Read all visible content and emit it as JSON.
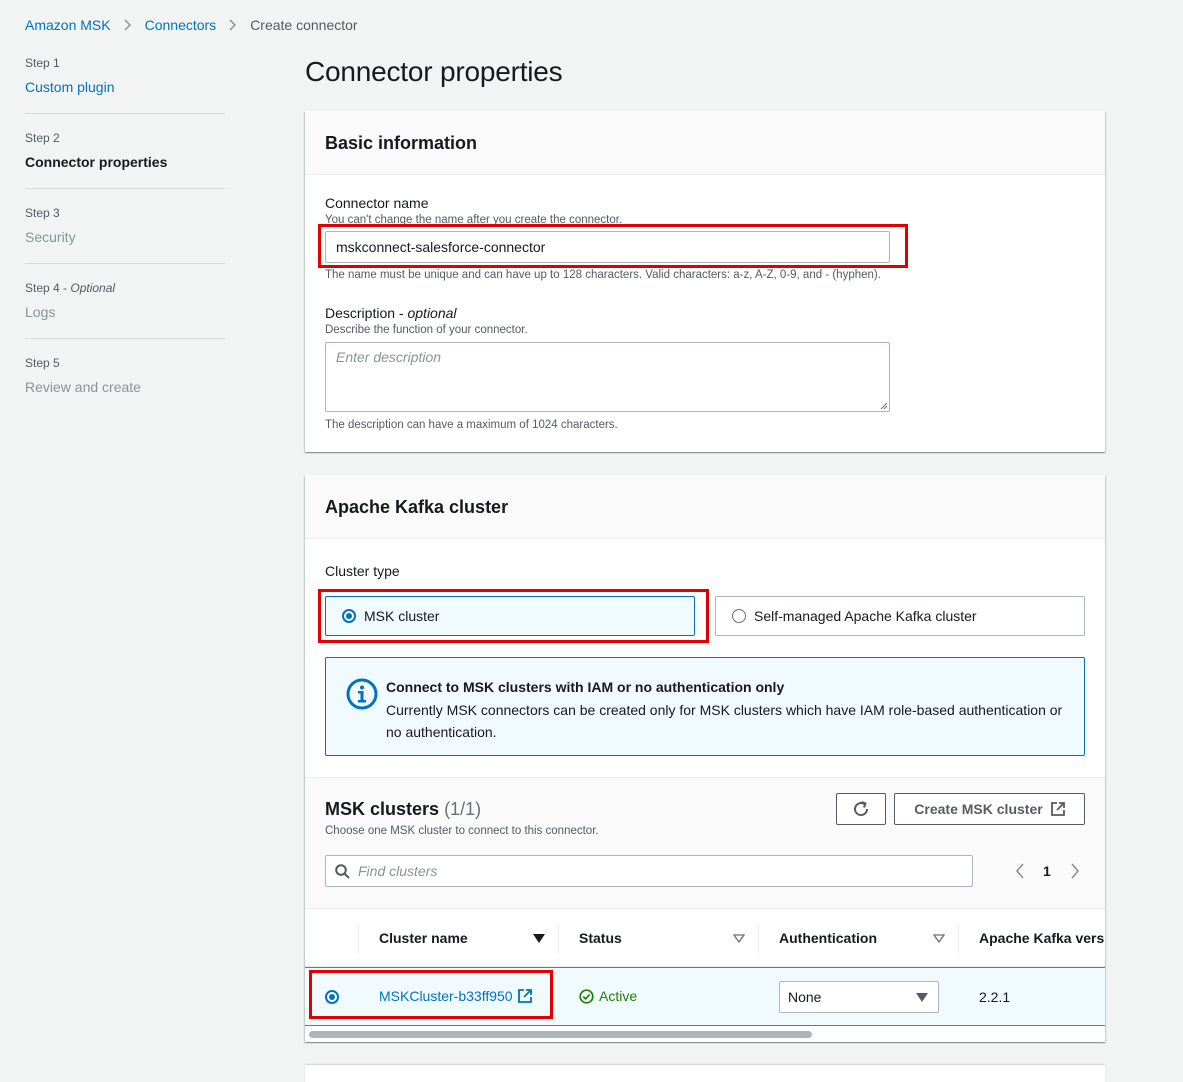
{
  "breadcrumb": {
    "items": [
      "Amazon MSK",
      "Connectors"
    ],
    "current": "Create connector"
  },
  "steps": [
    {
      "num": "Step 1",
      "title": "Custom plugin"
    },
    {
      "num": "Step 2",
      "title": "Connector properties"
    },
    {
      "num": "Step 3",
      "title": "Security"
    },
    {
      "num": "Step 4",
      "optional": "Optional",
      "title": "Logs"
    },
    {
      "num": "Step 5",
      "title": "Review and create"
    }
  ],
  "page_title": "Connector properties",
  "basic": {
    "header": "Basic information",
    "name_label": "Connector name",
    "name_desc": "You can't change the name after you create the connector.",
    "name_value": "mskconnect-salesforce-connector",
    "name_constraint": "The name must be unique and can have up to 128 characters. Valid characters: a-z, A-Z, 0-9, and - (hyphen).",
    "desc_label": "Description",
    "desc_optional": "optional",
    "desc_desc": "Describe the function of your connector.",
    "desc_placeholder": "Enter description",
    "desc_constraint": "The description can have a maximum of 1024 characters."
  },
  "kafka": {
    "header": "Apache Kafka cluster",
    "cluster_type_label": "Cluster type",
    "option_msk": "MSK cluster",
    "option_self": "Self-managed Apache Kafka cluster",
    "info_title": "Connect to MSK clusters with IAM or no authentication only",
    "info_text": "Currently MSK connectors can be created only for MSK clusters which have IAM role-based authentication or no authentication.",
    "clusters_title": "MSK clusters",
    "clusters_count": "(1/1)",
    "clusters_desc": "Choose one MSK cluster to connect to this connector.",
    "create_button": "Create MSK cluster",
    "search_placeholder": "Find clusters",
    "page_number": "1",
    "columns": [
      "Cluster name",
      "Status",
      "Authentication",
      "Apache Kafka versi"
    ],
    "row": {
      "name": "MSKCluster-b33ff950",
      "status": "Active",
      "authentication": "None",
      "version": "2.2.1"
    }
  },
  "colors": {
    "link": "#0073bb",
    "highlight": "#e10000",
    "active": "#1d8102"
  }
}
